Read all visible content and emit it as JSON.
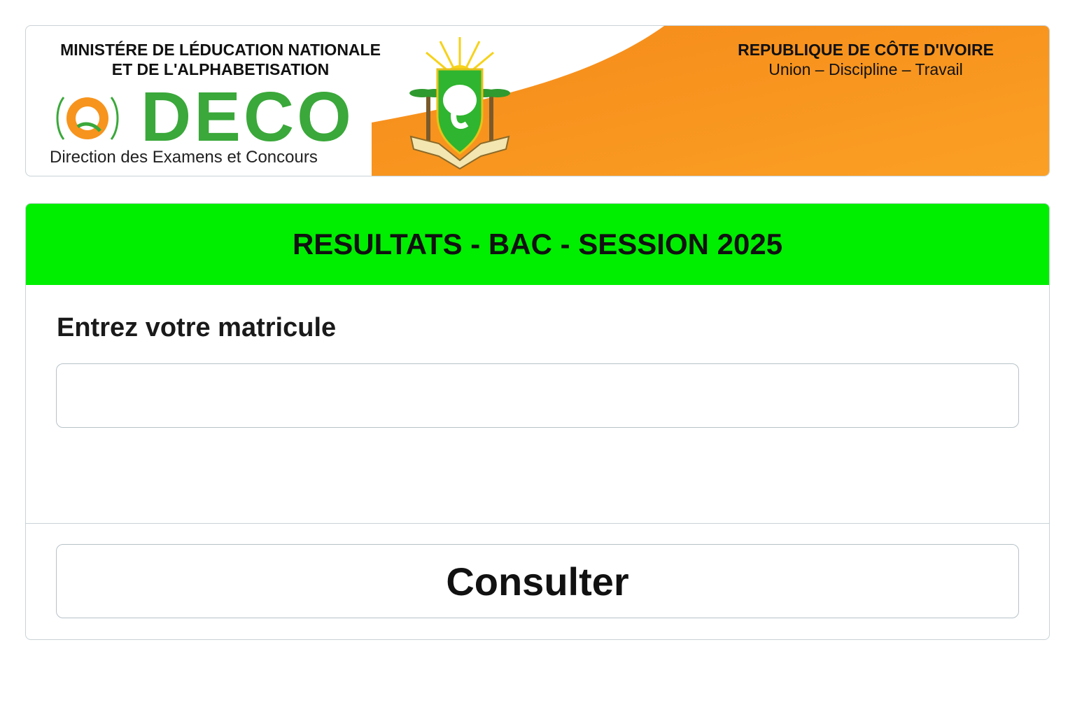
{
  "header": {
    "ministry_line1": "MINISTÉRE DE LÉDUCATION NATIONALE",
    "ministry_line2": "ET DE L'ALPHABETISATION",
    "deco_name": "DECO",
    "deco_subtitle": "Direction des Examens et Concours",
    "republic": "REPUBLIQUE DE CÔTE D'IVOIRE",
    "motto": "Union – Discipline – Travail",
    "colors": {
      "orange": "#f7941d",
      "green": "#3aa83a"
    }
  },
  "form": {
    "title": "RESULTATS - BAC - SESSION 2025",
    "label": "Entrez votre matricule",
    "input_value": "",
    "input_placeholder": "",
    "submit_label": "Consulter",
    "header_color": "#00ee00"
  }
}
